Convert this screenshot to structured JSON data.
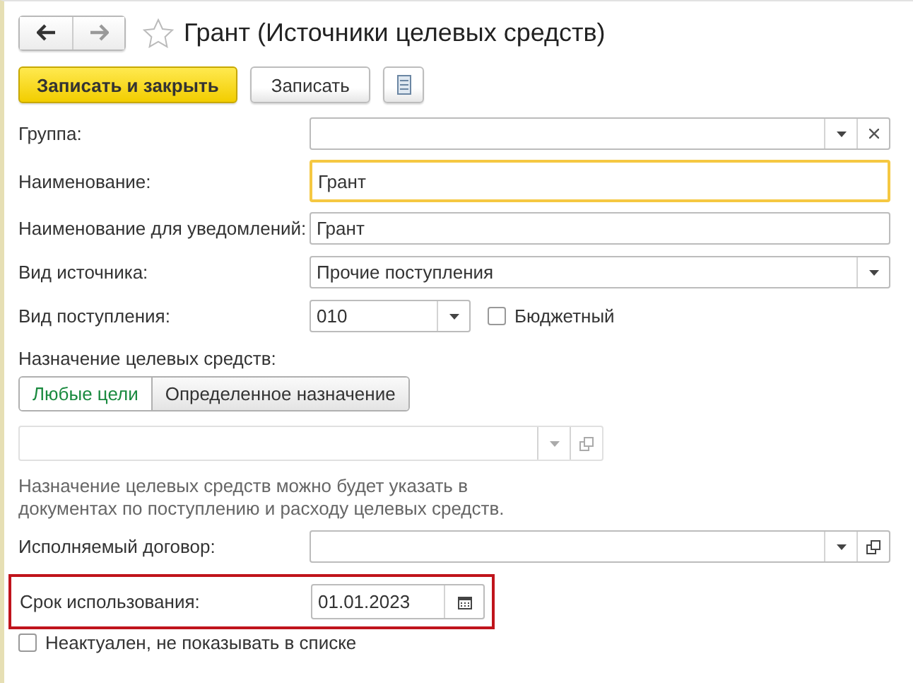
{
  "window": {
    "title": "Грант (Источники целевых средств)",
    "forward_enabled": false,
    "favorite": false
  },
  "toolbar": [
    {
      "kind": "primary",
      "label": "Записать и закрыть"
    },
    {
      "kind": "default",
      "label": "Записать"
    },
    {
      "kind": "menu"
    }
  ],
  "fields": [
    {
      "kind": "field",
      "label": "Группа:",
      "focused": false,
      "buttons": [
        {
          "kind": "dropdown"
        },
        {
          "kind": "clear"
        }
      ]
    },
    {
      "kind": "field",
      "label": "Наименование:",
      "value": "Грант",
      "focused": true
    },
    {
      "kind": "field",
      "label": "Наименование для уведомлений:",
      "value": "Грант",
      "focused": false
    },
    {
      "kind": "field",
      "label": "Вид источника:",
      "value": "Прочие поступления",
      "focused": false,
      "buttons": [
        {
          "kind": "dropdown"
        }
      ]
    },
    {
      "kind": "short-field",
      "label": "Вид поступления:",
      "value": "010",
      "focused": false,
      "buttons": [
        {
          "kind": "dropdown"
        }
      ],
      "checkbox": {
        "label": "Бюджетный",
        "checked": false
      }
    }
  ],
  "purpose": {
    "label": "Назначение целевых средств:",
    "options": [
      {
        "label": "Любые цели",
        "selected": true
      },
      {
        "label": "Определенное назначение",
        "selected": false
      }
    ],
    "field": {
      "disabled": true,
      "buttons": [
        {
          "kind": "dropdown"
        },
        {
          "kind": "open"
        }
      ]
    },
    "note": "Назначение целевых средств можно будет указать в документах по поступлению и расходу целевых средств."
  },
  "contract": {
    "label": "Исполняемый договор:",
    "buttons": [
      {
        "kind": "dropdown"
      },
      {
        "kind": "open"
      }
    ]
  },
  "term": {
    "label": "Срок использования:",
    "value": "01.01.2023",
    "highlighted": true,
    "buttons": [
      {
        "kind": "calendar"
      }
    ]
  },
  "inactive": {
    "label": "Неактуален, не показывать в списке",
    "checked": false
  }
}
